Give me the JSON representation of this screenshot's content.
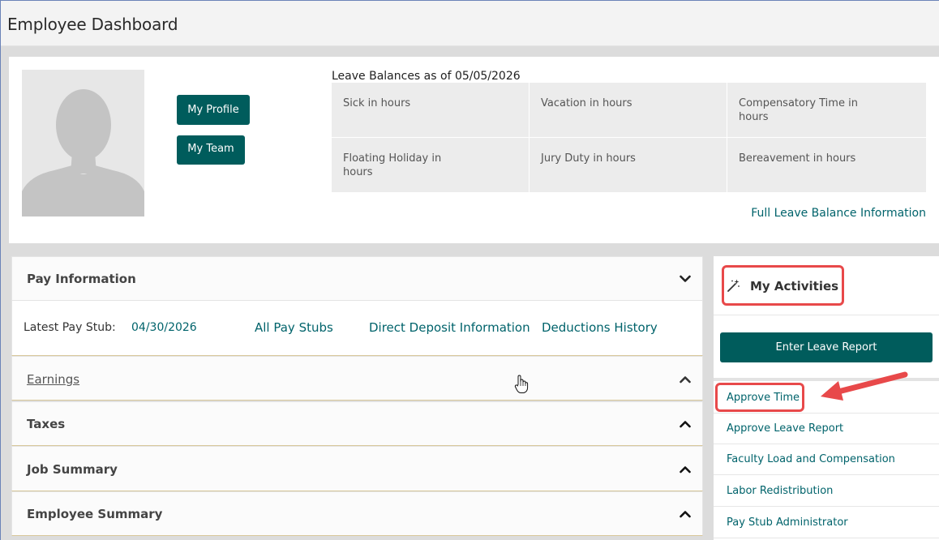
{
  "page": {
    "title": "Employee Dashboard"
  },
  "profile": {
    "my_profile_label": "My Profile",
    "my_team_label": "My Team"
  },
  "leave": {
    "title": "Leave Balances as of 05/05/2026",
    "cells": [
      "Sick in hours",
      "Vacation in hours",
      "Compensatory Time in hours",
      "Floating Holiday in hours",
      "Jury Duty in hours",
      "Bereavement in hours"
    ],
    "full_link": "Full Leave Balance Information"
  },
  "pay": {
    "header": "Pay Information",
    "latest_label": "Latest Pay Stub:",
    "latest_date": "04/30/2026",
    "links": [
      "All Pay Stubs",
      "Direct Deposit Information",
      "Deductions History"
    ]
  },
  "sections": {
    "earnings": "Earnings",
    "taxes": "Taxes",
    "job_summary": "Job Summary",
    "employee_summary": "Employee Summary"
  },
  "activities": {
    "title": "My Activities",
    "enter_leave_report": "Enter Leave Report",
    "links": [
      "Approve Time",
      "Approve Leave Report",
      "Faculty Load and Compensation",
      "Labor Redistribution",
      "Pay Stub Administrator"
    ]
  },
  "colors": {
    "teal": "#005c5c",
    "link": "#00636b",
    "highlight": "#e8494a"
  }
}
